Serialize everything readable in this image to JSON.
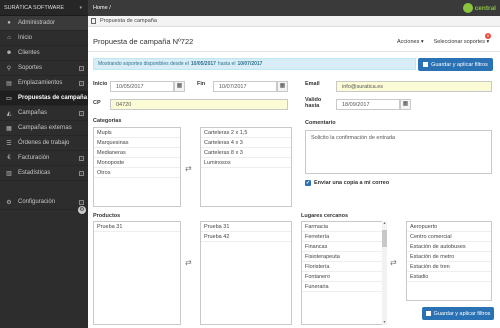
{
  "sidebar": {
    "title": "SURÁTICA SOFTWARE",
    "items": [
      {
        "label": "Administrador",
        "icon": "user-icon",
        "glyph": "●",
        "has_expand": false
      },
      {
        "label": "Inicio",
        "icon": "home-icon",
        "glyph": "⌂",
        "has_expand": false
      },
      {
        "label": "Clientes",
        "icon": "users-icon",
        "glyph": "☻",
        "has_expand": false
      },
      {
        "label": "Soportes",
        "icon": "pin-icon",
        "glyph": "⚲",
        "has_expand": true
      },
      {
        "label": "Emplazamientos",
        "icon": "chart-icon",
        "glyph": "▤",
        "has_expand": true
      },
      {
        "label": "Propuestas de campaña",
        "icon": "file-icon",
        "glyph": "▭",
        "has_expand": false
      },
      {
        "label": "Campañas",
        "icon": "megaphone-icon",
        "glyph": "◭",
        "has_expand": true
      },
      {
        "label": "Campañas externas",
        "icon": "grid-icon",
        "glyph": "▦",
        "has_expand": false
      },
      {
        "label": "Órdenes de trabajo",
        "icon": "list-icon",
        "glyph": "☰",
        "has_expand": false
      },
      {
        "label": "Facturación",
        "icon": "euro-icon",
        "glyph": "€",
        "has_expand": true
      },
      {
        "label": "Estadísticas",
        "icon": "bar-chart-icon",
        "glyph": "▥",
        "has_expand": true
      },
      {
        "label": "Configuración",
        "icon": "gear-icon",
        "glyph": "⚙",
        "has_expand": true
      }
    ]
  },
  "topbar": {
    "breadcrumb_home": "Home /",
    "logo_text": "central"
  },
  "breadcrumb": {
    "page": "Propuesta de campaña"
  },
  "header": {
    "title": "Propuesta de campaña Nº722",
    "actions_label": "Acciones ▾",
    "select_supports_label": "Seleccionar soportes ▾",
    "badge_count": "0"
  },
  "info": {
    "prefix": "Mostrando soportes disponibles desde el",
    "date_from": "10/05/2017",
    "middle": "hasta el",
    "date_to": "10/07/2017"
  },
  "buttons": {
    "save_filters": "Guardar y aplicar filtros"
  },
  "form": {
    "inicio_label": "Inicio",
    "inicio_value": "10/05/2017",
    "fin_label": "Fin",
    "fin_value": "10/07/2017",
    "email_label": "Email",
    "email_value": "info@suratica.es",
    "cp_label": "CP",
    "cp_value": "04720",
    "valido_label_1": "Valido",
    "valido_label_2": "hasta",
    "valido_value": "18/09/2017",
    "categorias_label": "Categorias",
    "comentario_label": "Comentario",
    "comentario_value": "Solicito la confirmación de entrada",
    "copy_label": "Enviar una copia a mi correo",
    "productos_label": "Productos",
    "lugares_label": "Lugares cercanos"
  },
  "categorias_available": [
    "Mupis",
    "Marquesinas",
    "Medianeras",
    "Monoposte",
    "Otros"
  ],
  "categorias_selected": [
    "Carteleras 2 x 1,5",
    "Carteleras 4 x 3",
    "Carteleras 8 x 3",
    "Luminosos"
  ],
  "productos_available": [
    "Prueba 31"
  ],
  "productos_selected": [
    "Prueba 31",
    "Prueba 42"
  ],
  "lugares_available": [
    "Farmacia",
    "Ferretería",
    "Financas",
    "Fisioterapeuta",
    "Floristería",
    "Fontanero",
    "Funeraria"
  ],
  "lugares_selected": [
    "Aeropuerto",
    "Centro comercial",
    "Estación de autobuses",
    "Estación de metro",
    "Estación de tren",
    "Estadio"
  ],
  "icons": {
    "calendar": "calendar-icon",
    "transfer": "transfer-icon",
    "check": "checkbox-checked-icon"
  },
  "colors": {
    "sidebar_bg": "#2d2d2d",
    "primary": "#2b72b5",
    "info_bg": "#d9edf7",
    "highlight": "#fbfbd5"
  }
}
